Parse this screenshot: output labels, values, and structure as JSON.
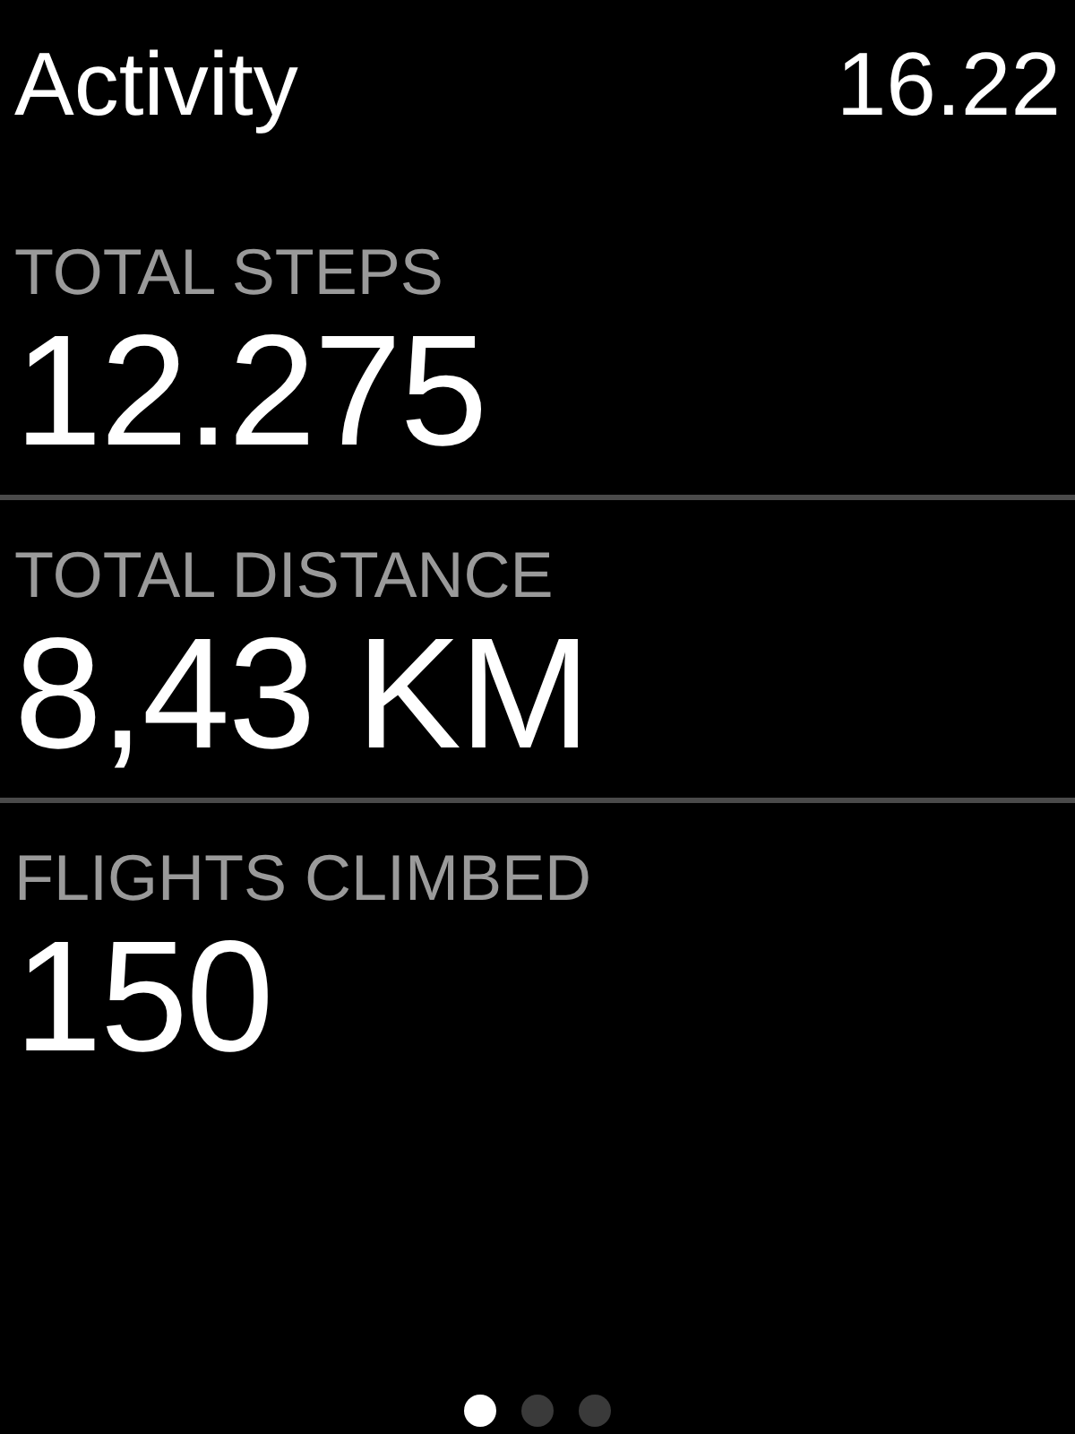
{
  "header": {
    "title": "Activity",
    "time": "16.22"
  },
  "metrics": [
    {
      "label": "TOTAL STEPS",
      "value": "12.275"
    },
    {
      "label": "TOTAL DISTANCE",
      "value": "8,43 KM"
    },
    {
      "label": "FLIGHTS CLIMBED",
      "value": "150"
    }
  ],
  "pages": [
    {
      "selected": true
    },
    {
      "selected": false
    },
    {
      "selected": false
    }
  ]
}
